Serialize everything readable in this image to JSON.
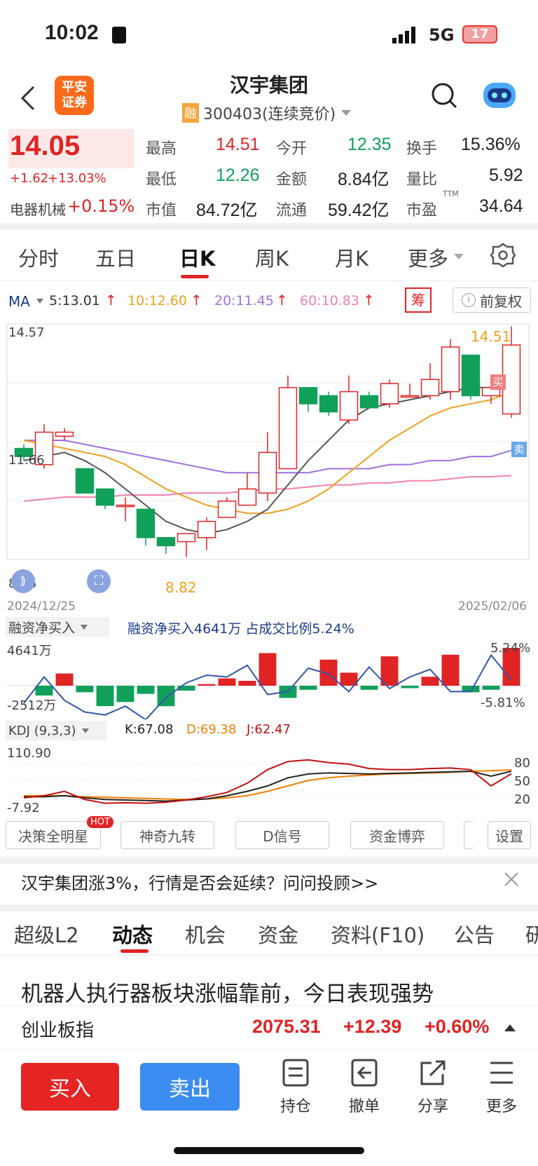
{
  "status_bar": {
    "time": "10:02",
    "network": "5G",
    "battery": "17"
  },
  "header": {
    "title": "汉宇集团",
    "margin_badge": "融",
    "code": "300403(连续竞价)",
    "broker_logo_line1": "平安",
    "broker_logo_line2": "证券"
  },
  "quote": {
    "price": "14.05",
    "change": "+1.62",
    "change_pct": "+13.03%",
    "sector": "电器机械",
    "sector_pct": "+0.15%",
    "high_label": "最高",
    "high": "14.51",
    "open_label": "今开",
    "open": "12.35",
    "turnover_label": "换手",
    "turnover": "15.36%",
    "low_label": "最低",
    "low": "12.26",
    "amount_label": "金额",
    "amount": "8.84亿",
    "volratio_label": "量比",
    "volratio": "5.92",
    "mktcap_label": "市值",
    "mktcap": "84.72亿",
    "float_label": "流通",
    "float": "59.42亿",
    "pe_label": "市盈",
    "pe_sup": "TTM",
    "pe": "34.64"
  },
  "chart_tabs": [
    "分时",
    "五日",
    "日K",
    "周K",
    "月K",
    "更多"
  ],
  "ma_bar": {
    "label": "MA",
    "ma5": "5:13.01",
    "ma10": "10:12.60",
    "ma20": "20:11.45",
    "ma60": "60:10.83",
    "chip": "筹",
    "adjust": "前复权",
    "ma5_color": "#333333",
    "ma10_color": "#f0a020",
    "ma20_color": "#a070e0",
    "ma60_color": "#f080b0"
  },
  "kline": {
    "y_top": "14.57",
    "y_mid": "11.66",
    "y_bot": "8.76",
    "high_mark": "14.51",
    "low_mark": "8.82",
    "date_start": "2024/12/25",
    "date_end": "2025/02/06",
    "buy_tag": "买",
    "sell_tag": "卖"
  },
  "margin_panel": {
    "selector": "融资净买入",
    "summary": "融资净买入4641万  占成交比例5.24%",
    "y_top": "4641万",
    "y_bot": "-2512万",
    "pct_top": "5.24%",
    "pct_bot": "-5.81%"
  },
  "kdj_panel": {
    "selector": "KDJ (9,3,3)",
    "k": "K:67.08",
    "d": "D:69.38",
    "j": "J:62.47",
    "y_top": "110.90",
    "y_bot": "-7.92",
    "l80": "80",
    "l50": "50",
    "l20": "20"
  },
  "tool_buttons": [
    "决策全明星",
    "神奇九转",
    "D信号",
    "资金博弈"
  ],
  "tool_hot": "HOT",
  "tool_settings": "设置",
  "banner": {
    "text": "汉宇集团涨3%，行情是否会延续？问问投顾>>"
  },
  "news_tabs": [
    "超级L2",
    "动态",
    "机会",
    "资金",
    "资料(F10)",
    "公告",
    "研"
  ],
  "headline": "机器人执行器板块涨幅靠前，今日表现强势",
  "index_ticker": {
    "name": "创业板指",
    "value": "2075.31",
    "change": "+12.39",
    "pct": "+0.60%"
  },
  "bottom_bar": {
    "buy": "买入",
    "sell": "卖出",
    "hold": "持仓",
    "cancel": "撤单",
    "share": "分享",
    "more": "更多"
  },
  "chart_data": {
    "type": "candlestick",
    "x_start": "2024/12/25",
    "x_end": "2025/02/06",
    "ylim": [
      8.76,
      14.57
    ],
    "candles": [
      {
        "o": 11.5,
        "c": 11.3,
        "h": 11.6,
        "l": 11.2
      },
      {
        "o": 11.1,
        "c": 11.9,
        "h": 12.1,
        "l": 11.0
      },
      {
        "o": 11.8,
        "c": 11.9,
        "h": 12.0,
        "l": 11.7
      },
      {
        "o": 11.0,
        "c": 10.4,
        "h": 11.0,
        "l": 10.4
      },
      {
        "o": 10.5,
        "c": 10.1,
        "h": 10.5,
        "l": 10.0
      },
      {
        "o": 10.1,
        "c": 10.1,
        "h": 10.3,
        "l": 9.7
      },
      {
        "o": 10.0,
        "c": 9.3,
        "h": 10.0,
        "l": 9.1
      },
      {
        "o": 9.3,
        "c": 9.1,
        "h": 9.3,
        "l": 8.9
      },
      {
        "o": 9.2,
        "c": 9.4,
        "h": 9.4,
        "l": 8.82
      },
      {
        "o": 9.3,
        "c": 9.7,
        "h": 9.8,
        "l": 9.0
      },
      {
        "o": 9.8,
        "c": 10.2,
        "h": 10.3,
        "l": 9.8
      },
      {
        "o": 10.1,
        "c": 10.5,
        "h": 10.9,
        "l": 10.1
      },
      {
        "o": 10.4,
        "c": 11.4,
        "h": 11.9,
        "l": 10.2
      },
      {
        "o": 11.0,
        "c": 13.0,
        "h": 13.3,
        "l": 11.0
      },
      {
        "o": 13.0,
        "c": 12.6,
        "h": 13.0,
        "l": 12.4
      },
      {
        "o": 12.8,
        "c": 12.4,
        "h": 12.9,
        "l": 12.3
      },
      {
        "o": 12.2,
        "c": 12.9,
        "h": 13.3,
        "l": 12.1
      },
      {
        "o": 12.8,
        "c": 12.5,
        "h": 12.9,
        "l": 12.5
      },
      {
        "o": 12.6,
        "c": 13.1,
        "h": 13.2,
        "l": 12.5
      },
      {
        "o": 12.8,
        "c": 12.8,
        "h": 13.1,
        "l": 12.8
      },
      {
        "o": 12.8,
        "c": 13.2,
        "h": 13.6,
        "l": 12.7
      },
      {
        "o": 12.9,
        "c": 14.0,
        "h": 14.2,
        "l": 12.7
      },
      {
        "o": 13.8,
        "c": 12.8,
        "h": 13.8,
        "l": 12.7
      },
      {
        "o": 12.8,
        "c": 13.0,
        "h": 13.2,
        "l": 12.6
      },
      {
        "o": 12.35,
        "c": 14.05,
        "h": 14.51,
        "l": 12.26
      }
    ],
    "ma5": [
      11.2,
      11.3,
      11.4,
      11.2,
      10.9,
      10.5,
      10.1,
      9.7,
      9.5,
      9.4,
      9.5,
      9.7,
      10.0,
      10.6,
      11.2,
      11.7,
      12.2,
      12.5,
      12.6,
      12.7,
      12.8,
      12.9,
      13.0,
      13.0,
      13.3
    ],
    "ma10": [
      11.7,
      11.6,
      11.5,
      11.4,
      11.3,
      11.1,
      10.8,
      10.5,
      10.3,
      10.1,
      10.0,
      9.9,
      9.9,
      10.0,
      10.2,
      10.5,
      10.9,
      11.3,
      11.7,
      12.0,
      12.3,
      12.5,
      12.6,
      12.7,
      12.9
    ],
    "ma20": [
      11.7,
      11.7,
      11.7,
      11.6,
      11.5,
      11.4,
      11.3,
      11.2,
      11.1,
      11.0,
      10.9,
      10.9,
      10.9,
      10.9,
      10.9,
      11.0,
      11.0,
      11.0,
      11.1,
      11.1,
      11.2,
      11.2,
      11.3,
      11.3,
      11.45
    ],
    "ma60": [
      10.2,
      10.25,
      10.3,
      10.3,
      10.3,
      10.35,
      10.35,
      10.35,
      10.4,
      10.4,
      10.4,
      10.45,
      10.5,
      10.5,
      10.55,
      10.6,
      10.6,
      10.65,
      10.65,
      10.7,
      10.7,
      10.75,
      10.8,
      10.8,
      10.83
    ],
    "margin_net_buy": [
      -1200,
      1500,
      -800,
      -2500,
      -2000,
      -1000,
      -2512,
      -600,
      200,
      900,
      600,
      4000,
      -1500,
      -500,
      3200,
      1600,
      -500,
      3600,
      -300,
      1100,
      3800,
      -800,
      -500,
      4641
    ],
    "margin_pct": [
      -3.0,
      1.5,
      -2.5,
      -4.5,
      -5.0,
      -3.5,
      -5.81,
      -2.0,
      0.5,
      1.8,
      1.5,
      3.5,
      -1.5,
      -1.0,
      3.0,
      2.0,
      -1.0,
      3.2,
      -0.5,
      1.5,
      2.8,
      -1.0,
      -1.0,
      5.24,
      1.0
    ],
    "kdj_k": [
      20,
      20,
      22,
      18,
      15,
      14,
      13,
      12,
      14,
      16,
      22,
      30,
      40,
      55,
      62,
      64,
      63,
      62,
      63,
      64,
      65,
      66,
      67,
      58,
      67.08
    ],
    "kdj_d": [
      22,
      22,
      22,
      20,
      19,
      18,
      17,
      16,
      15,
      16,
      18,
      22,
      30,
      40,
      50,
      55,
      58,
      60,
      62,
      63,
      64,
      65,
      67,
      68,
      69.38
    ],
    "kdj_j": [
      18,
      22,
      30,
      15,
      8,
      9,
      8,
      10,
      14,
      20,
      28,
      45,
      70,
      85,
      88,
      83,
      80,
      72,
      70,
      70,
      72,
      73,
      70,
      40,
      62.47
    ]
  }
}
